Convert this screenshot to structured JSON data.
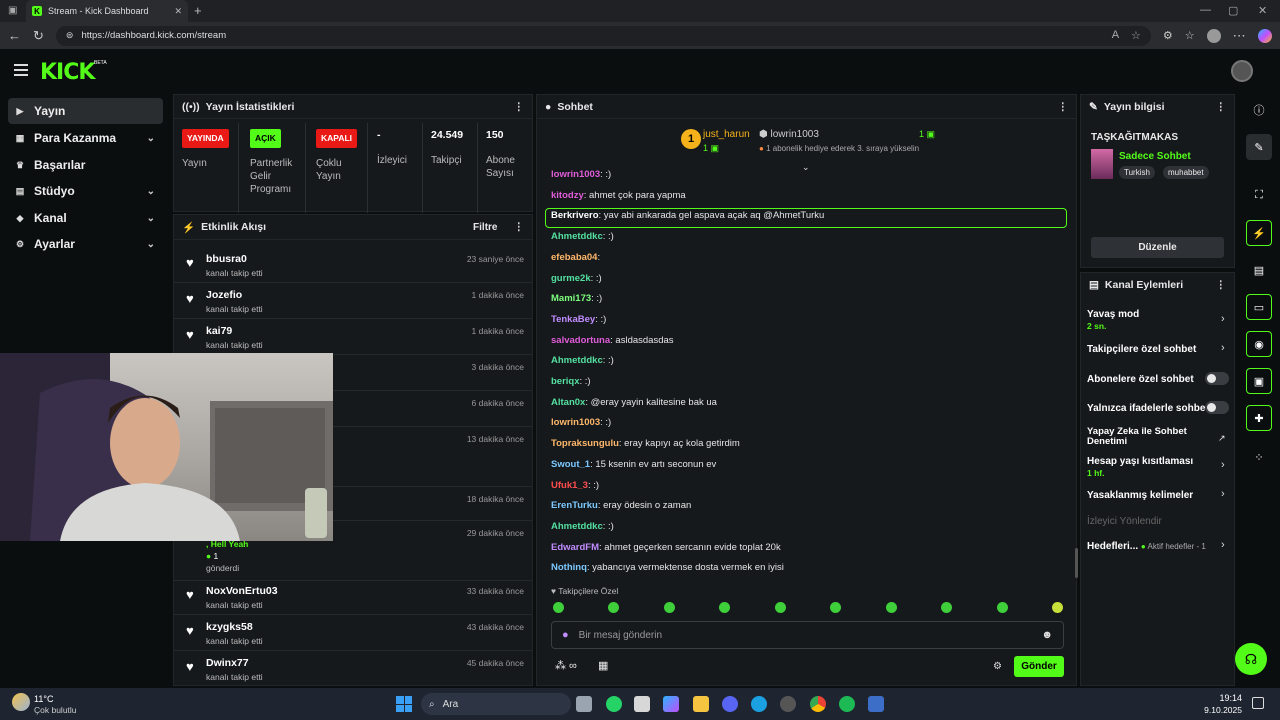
{
  "browser": {
    "tab_title": "Stream - Kick Dashboard",
    "url": "https://dashboard.kick.com/stream"
  },
  "header": {
    "logo": "KICK",
    "beta": "BETA"
  },
  "sidebar": {
    "items": [
      {
        "label": "Yayın",
        "icon": "video-icon",
        "active": true,
        "chevron": false
      },
      {
        "label": "Para Kazanma",
        "icon": "money-icon",
        "chevron": true
      },
      {
        "label": "Başarılar",
        "icon": "trophy-icon",
        "chevron": false
      },
      {
        "label": "Stüdyo",
        "icon": "studio-icon",
        "chevron": true
      },
      {
        "label": "Kanal",
        "icon": "channel-icon",
        "chevron": true
      },
      {
        "label": "Ayarlar",
        "icon": "gear-icon",
        "chevron": true
      }
    ]
  },
  "stats": {
    "title": "Yayın İstatistikleri",
    "items": [
      {
        "badge": "YAYINDA",
        "badge_color": "#e91916",
        "label": "Yayın"
      },
      {
        "badge": "AÇIK",
        "badge_color": "#53fc18",
        "label": "Partnerlik Gelir Programı"
      },
      {
        "badge": "KAPALI",
        "badge_color": "#e91916",
        "label": "Çoklu Yayın"
      },
      {
        "value": "-",
        "label": "İzleyici"
      },
      {
        "value": "24.549",
        "label": "Takipçi"
      },
      {
        "value": "150",
        "label": "Abone Sayısı"
      }
    ]
  },
  "activity": {
    "title": "Etkinlik Akışı",
    "filter": "Filtre",
    "items": [
      {
        "name": "bbusra0",
        "sub": "kanalı takip etti",
        "time": "23 saniye önce"
      },
      {
        "name": "Jozefio",
        "sub": "kanalı takip etti",
        "time": "1 dakika önce"
      },
      {
        "name": "kai79",
        "sub": "kanalı takip etti",
        "time": "1 dakika önce"
      },
      {
        "name": "",
        "sub": "",
        "time": "3 dakika önce"
      },
      {
        "name": "",
        "sub": "",
        "time": "6 dakika önce"
      },
      {
        "name": "",
        "sub": "",
        "time": "13 dakika önce"
      },
      {
        "name": "",
        "sub": "",
        "time": "18 dakika önce"
      },
      {
        "name": ", Hell Yeah",
        "sub": "gönderdi",
        "time": "29 dakika önce",
        "count": "1"
      },
      {
        "name": "NoxVonErtu03",
        "sub": "kanalı takip etti",
        "time": "33 dakika önce"
      },
      {
        "name": "kzygks58",
        "sub": "kanalı takip etti",
        "time": "43 dakika önce"
      },
      {
        "name": "Dwinx77",
        "sub": "kanalı takip etti",
        "time": "45 dakika önce"
      }
    ]
  },
  "chat": {
    "title": "Sohbet",
    "pinned": {
      "rank": "1",
      "user1": "just_harun",
      "count1": "1",
      "user2": "lowrin1003",
      "count2": "1",
      "note": "1 abonelik hediye ederek 3. sıraya yükselin"
    },
    "messages": [
      {
        "user": "lowrin1003",
        "text": ": :)",
        "color": "#e05cd9"
      },
      {
        "user": "kitodzy",
        "text": ": ahmet çok para yapma",
        "color": "#e05cd9"
      },
      {
        "user": "Berkrivero",
        "text": ": yav abi ankarada gel aspava açak aq @AhmetTurku",
        "color": "#ffffff"
      },
      {
        "user": "Ahmetddkc",
        "text": ": :)",
        "color": "#53e0a0"
      },
      {
        "user": "efebaba04",
        "text": ":",
        "color": "#ffb86b"
      },
      {
        "user": "gurme2k",
        "text": ": :)",
        "color": "#53e0a0"
      },
      {
        "user": "Mami173",
        "text": ": :)",
        "color": "#7cff7c"
      },
      {
        "user": "TenkaBey",
        "text": ": :)",
        "color": "#c08cff"
      },
      {
        "user": "salvadortuna",
        "text": ": asldasdasdas",
        "color": "#e05cd9"
      },
      {
        "user": "Ahmetddkc",
        "text": ": :)",
        "color": "#53e0a0"
      },
      {
        "user": "beriqx",
        "text": ": :)",
        "color": "#53e0a0"
      },
      {
        "user": "Altan0x",
        "text": ": @eray yayin kalitesine bak ua",
        "color": "#53e0a0"
      },
      {
        "user": "lowrin1003",
        "text": ": :)",
        "color": "#ffb86b"
      },
      {
        "user": "Topraksungulu",
        "text": ": eray kapıyı aç kola getirdim",
        "color": "#ffb86b"
      },
      {
        "user": "Swout_1",
        "text": ": 15 ksenin ev artı seconun ev",
        "color": "#7cc8ff"
      },
      {
        "user": "Ufuk1_3",
        "text": ": :)",
        "color": "#ff4d4d"
      },
      {
        "user": "ErenTurku",
        "text": ": eray ödesin o zaman",
        "color": "#7cc8ff"
      },
      {
        "user": "Ahmetddkc",
        "text": ": :)",
        "color": "#53e0a0"
      },
      {
        "user": "EdwardFM",
        "text": ": ahmet geçerken sercanın evide toplat 20k",
        "color": "#c08cff"
      },
      {
        "user": "Nothinq",
        "text": ": yabancıya vermektense dosta vermek en iyisi",
        "color": "#7cc8ff"
      }
    ],
    "followers_only": "Takipçilere Özel",
    "input_placeholder": "Bir mesaj gönderin",
    "send": "Gönder"
  },
  "info": {
    "title": "Yayın bilgisi",
    "stream_title": "TAŞKAĞITMAKAS",
    "category": "Sadece Sohbet",
    "tags": [
      "Turkish",
      "muhabbet"
    ],
    "edit": "Düzenle"
  },
  "actions": {
    "title": "Kanal Eylemleri",
    "items": [
      {
        "label": "Yavaş mod",
        "sub": "2 sn.",
        "control": "chevron"
      },
      {
        "label": "Takipçilere özel sohbet",
        "control": "chevron"
      },
      {
        "label": "Abonelere özel sohbet",
        "control": "toggle"
      },
      {
        "label": "Yalnızca ifadelerle sohbet",
        "control": "toggle"
      },
      {
        "label": "Yapay Zeka ile Sohbet Denetimi",
        "control": "external"
      },
      {
        "label": "Hesap yaşı kısıtlaması",
        "sub": "1 hf.",
        "control": "chevron"
      },
      {
        "label": "Yasaklanmış kelimeler",
        "control": "chevron"
      },
      {
        "label": "İzleyici Yönlendir",
        "control": "none"
      },
      {
        "label": "Hedefleri...",
        "sub2": "Aktif hedefler - 1",
        "control": "chevron"
      }
    ]
  },
  "taskbar": {
    "weather_temp": "11°C",
    "weather_desc": "Çok bulutlu",
    "search": "Ara",
    "time": "19:14",
    "date": "9.10.2025"
  }
}
